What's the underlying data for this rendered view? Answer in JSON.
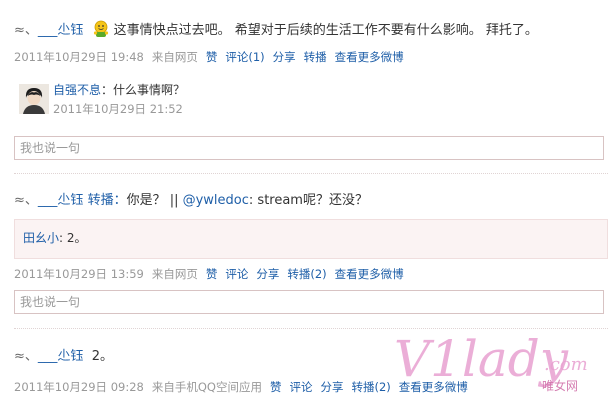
{
  "posts": [
    {
      "prefix": "≈、",
      "username": "___尐钰",
      "emoji": "green-smiley-emoji",
      "text": "这事情快点过去吧。 希望对于后续的生活工作不要有什么影响。 拜托了。",
      "time": "2011年10月29日 19:48",
      "source": "来自网页",
      "actions": {
        "like": "赞",
        "comment": "评论(1)",
        "share": "分享",
        "repost": "转播",
        "more": "查看更多微博"
      },
      "comments": [
        {
          "author": "自强不息",
          "text": "：什么事情啊？",
          "time": "2011年10月29日 21:52"
        }
      ],
      "reply_placeholder": "我也说一句"
    },
    {
      "prefix": "≈、",
      "username": "___尐钰",
      "repost_label": "转播：",
      "text_before": "你是？ || ",
      "mention": "@ywledoc",
      "text_after": ": stream呢？还没？",
      "quote": {
        "author": "田幺小",
        "text": ": 2。"
      },
      "time": "2011年10月29日 13:59",
      "source": "来自网页",
      "actions": {
        "like": "赞",
        "comment": "评论",
        "share": "分享",
        "repost": "转播(2)",
        "more": "查看更多微博"
      },
      "reply_placeholder": "我也说一句"
    },
    {
      "prefix": "≈、",
      "username": "___尐钰",
      "text": "2。",
      "time": "2011年10月29日 09:28",
      "source": "来自手机QQ空间应用",
      "actions": {
        "like": "赞",
        "comment": "评论",
        "share": "分享",
        "repost": "转播(2)",
        "more": "查看更多微博"
      }
    }
  ],
  "watermark": {
    "logo": "V1lady",
    "domain": ".com",
    "tagline": "唯女网"
  },
  "colors": {
    "link": "#1f5fa8",
    "muted": "#999999",
    "watermark": "#e8a0d0"
  }
}
